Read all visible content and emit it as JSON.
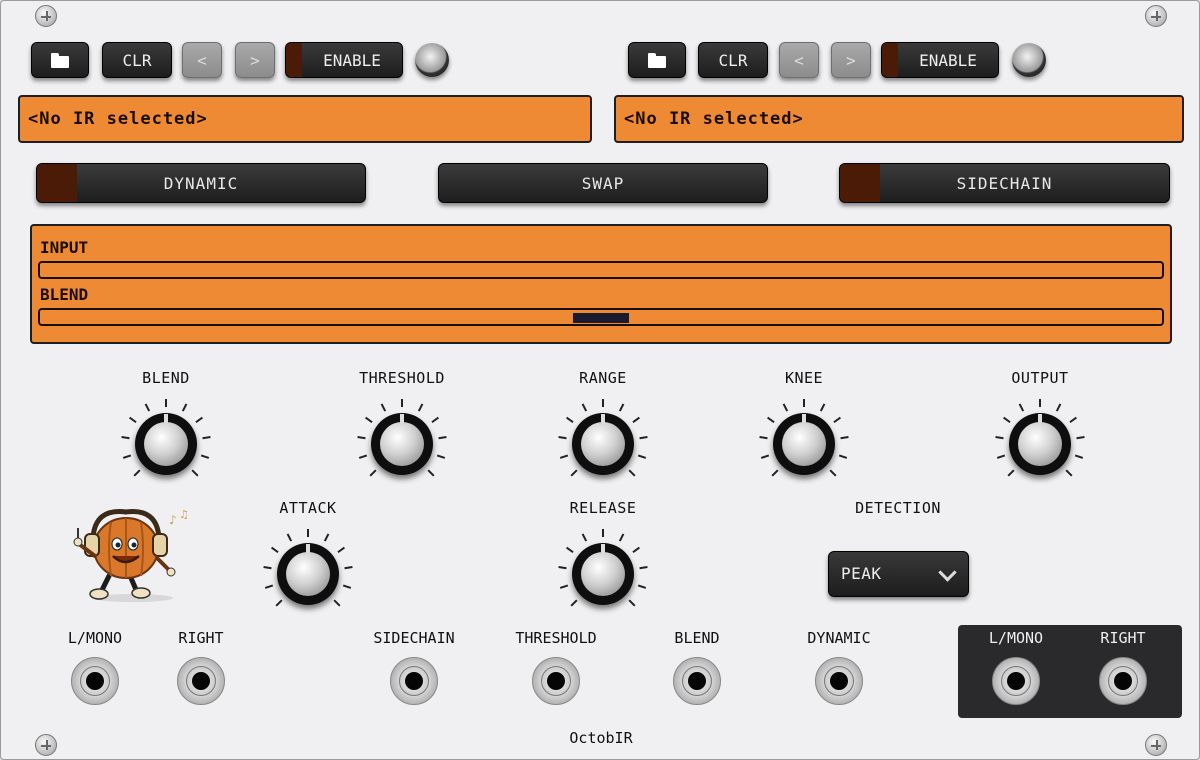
{
  "left_loader": {
    "clear_label": "CLR",
    "prev_label": "<",
    "next_label": ">",
    "enable_label": "ENABLE",
    "display_text": "<No IR selected>"
  },
  "right_loader": {
    "clear_label": "CLR",
    "prev_label": "<",
    "next_label": ">",
    "enable_label": "ENABLE",
    "display_text": "<No IR selected>"
  },
  "mode_buttons": {
    "dynamic": "DYNAMIC",
    "swap": "SWAP",
    "sidechain": "SIDECHAIN"
  },
  "meters": {
    "input_label": "INPUT",
    "blend_label": "BLEND",
    "blend_position": 0.5
  },
  "knobs": {
    "blend": "BLEND",
    "threshold": "THRESHOLD",
    "range": "RANGE",
    "knee": "KNEE",
    "output": "OUTPUT",
    "attack": "ATTACK",
    "release": "RELEASE"
  },
  "detection": {
    "label": "DETECTION",
    "value": "PEAK"
  },
  "inputs": {
    "l_mono": "L/MONO",
    "right": "RIGHT",
    "sidechain": "SIDECHAIN",
    "threshold": "THRESHOLD",
    "blend": "BLEND",
    "dynamic": "DYNAMIC"
  },
  "outputs": {
    "l_mono": "L/MONO",
    "right": "RIGHT"
  },
  "brand": "OctobIR",
  "colors": {
    "lcd": "#ef8a34",
    "panel": "#f0f0f2",
    "led_off": "#4a1c07"
  }
}
